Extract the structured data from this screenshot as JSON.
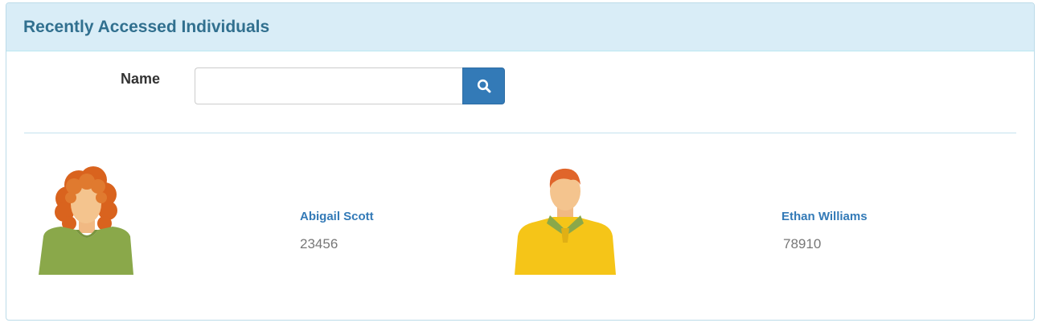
{
  "panel": {
    "title": "Recently Accessed Individuals"
  },
  "search": {
    "label": "Name",
    "value": "",
    "placeholder": "",
    "button_icon": "search-icon"
  },
  "individuals": [
    {
      "name": "Abigail Scott",
      "id": "23456",
      "avatar_icon": "female-avatar-icon"
    },
    {
      "name": "Ethan Williams",
      "id": "78910",
      "avatar_icon": "male-avatar-icon"
    }
  ],
  "colors": {
    "heading_bg": "#d9edf7",
    "heading_text": "#31708f",
    "primary": "#337ab7",
    "muted_text": "#777777",
    "female_shirt": "#8aa84a",
    "male_shirt": "#f5c518",
    "hair": "#d9631e",
    "skin": "#f4c48e"
  }
}
